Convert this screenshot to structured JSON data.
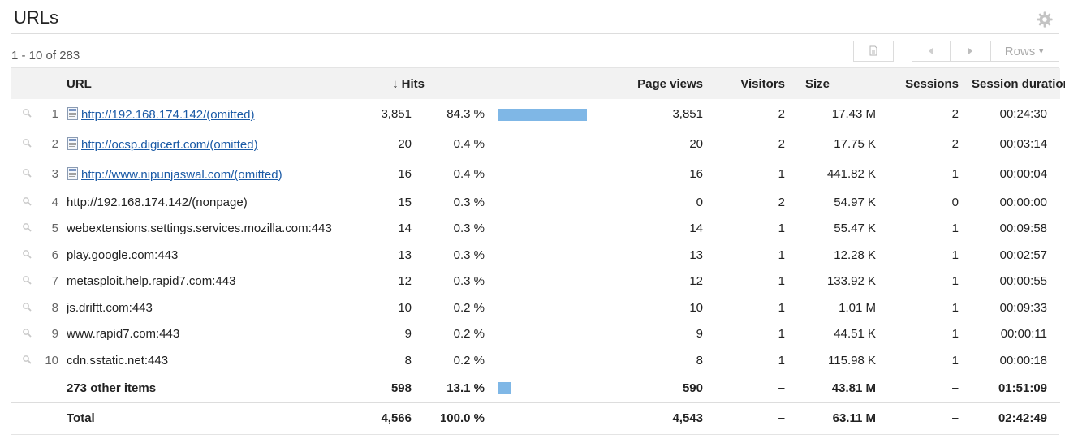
{
  "header": {
    "title": "URLs",
    "settings_icon": "gear-icon"
  },
  "toolbar": {
    "range_text": "1 - 10 of 283",
    "rows_label": "Rows",
    "export_icon": "document-icon",
    "prev_icon": "triangle-left-icon",
    "next_icon": "triangle-right-icon"
  },
  "columns": {
    "url": "URL",
    "hits": "Hits",
    "page_views": "Page views",
    "visitors": "Visitors",
    "size": "Size",
    "sessions": "Sessions",
    "session_duration": "Session duration"
  },
  "rows": [
    {
      "n": "1",
      "url": "http://192.168.174.142/(omitted)",
      "is_link": true,
      "hits": "3,851",
      "pct": "84.3 %",
      "bar": 0.843,
      "page_views": "3,851",
      "visitors": "2",
      "size": "17.43 M",
      "sessions": "2",
      "duration": "00:24:30"
    },
    {
      "n": "2",
      "url": "http://ocsp.digicert.com/(omitted)",
      "is_link": true,
      "hits": "20",
      "pct": "0.4 %",
      "bar": 0,
      "page_views": "20",
      "visitors": "2",
      "size": "17.75 K",
      "sessions": "2",
      "duration": "00:03:14"
    },
    {
      "n": "3",
      "url": "http://www.nipunjaswal.com/(omitted)",
      "is_link": true,
      "hits": "16",
      "pct": "0.4 %",
      "bar": 0,
      "page_views": "16",
      "visitors": "1",
      "size": "441.82 K",
      "sessions": "1",
      "duration": "00:00:04"
    },
    {
      "n": "4",
      "url": "http://192.168.174.142/(nonpage)",
      "is_link": false,
      "hits": "15",
      "pct": "0.3 %",
      "bar": 0,
      "page_views": "0",
      "visitors": "2",
      "size": "54.97 K",
      "sessions": "0",
      "duration": "00:00:00"
    },
    {
      "n": "5",
      "url": "webextensions.settings.services.mozilla.com:443",
      "is_link": false,
      "hits": "14",
      "pct": "0.3 %",
      "bar": 0,
      "page_views": "14",
      "visitors": "1",
      "size": "55.47 K",
      "sessions": "1",
      "duration": "00:09:58"
    },
    {
      "n": "6",
      "url": "play.google.com:443",
      "is_link": false,
      "hits": "13",
      "pct": "0.3 %",
      "bar": 0,
      "page_views": "13",
      "visitors": "1",
      "size": "12.28 K",
      "sessions": "1",
      "duration": "00:02:57"
    },
    {
      "n": "7",
      "url": "metasploit.help.rapid7.com:443",
      "is_link": false,
      "hits": "12",
      "pct": "0.3 %",
      "bar": 0,
      "page_views": "12",
      "visitors": "1",
      "size": "133.92 K",
      "sessions": "1",
      "duration": "00:00:55"
    },
    {
      "n": "8",
      "url": "js.driftt.com:443",
      "is_link": false,
      "hits": "10",
      "pct": "0.2 %",
      "bar": 0,
      "page_views": "10",
      "visitors": "1",
      "size": "1.01 M",
      "sessions": "1",
      "duration": "00:09:33"
    },
    {
      "n": "9",
      "url": "www.rapid7.com:443",
      "is_link": false,
      "hits": "9",
      "pct": "0.2 %",
      "bar": 0,
      "page_views": "9",
      "visitors": "1",
      "size": "44.51 K",
      "sessions": "1",
      "duration": "00:00:11"
    },
    {
      "n": "10",
      "url": "cdn.sstatic.net:443",
      "is_link": false,
      "hits": "8",
      "pct": "0.2 %",
      "bar": 0,
      "page_views": "8",
      "visitors": "1",
      "size": "115.98 K",
      "sessions": "1",
      "duration": "00:00:18"
    }
  ],
  "other": {
    "label": "273 other items",
    "hits": "598",
    "pct": "13.1 %",
    "bar": 0.131,
    "page_views": "590",
    "visitors": "–",
    "size": "43.81 M",
    "sessions": "–",
    "duration": "01:51:09"
  },
  "total": {
    "label": "Total",
    "hits": "4,566",
    "pct": "100.0 %",
    "page_views": "4,543",
    "visitors": "–",
    "size": "63.11 M",
    "sessions": "–",
    "duration": "02:42:49"
  },
  "colors": {
    "bar": "#7fb7e6",
    "link": "#1a5aa6",
    "header_bg": "#f2f2f2"
  }
}
